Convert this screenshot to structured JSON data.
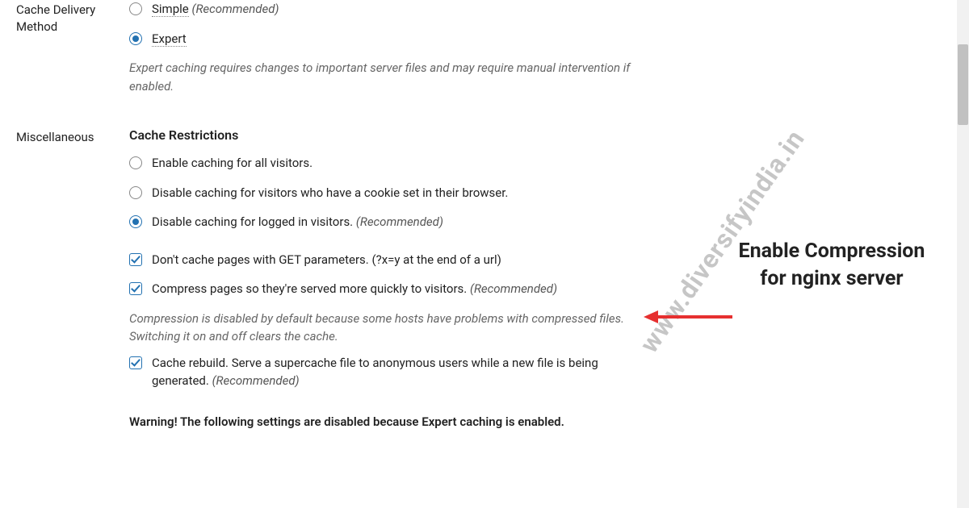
{
  "cache_delivery": {
    "label": "Cache Delivery Method",
    "options": {
      "simple": {
        "label": "Simple",
        "rec": "(Recommended)"
      },
      "expert": {
        "label": "Expert"
      }
    },
    "desc": "Expert caching requires changes to important server files and may require manual intervention if enabled."
  },
  "misc": {
    "label": "Miscellaneous",
    "subhead": "Cache Restrictions",
    "restrictions": {
      "all": "Enable caching for all visitors.",
      "cookie": "Disable caching for visitors who have a cookie set in their browser.",
      "logged": "Disable caching for logged in visitors.",
      "logged_rec": "(Recommended)"
    },
    "get_params": "Don't cache pages with GET parameters. (?x=y at the end of a url)",
    "compress": "Compress pages so they're served more quickly to visitors.",
    "compress_rec": "(Recommended)",
    "compress_desc": "Compression is disabled by default because some hosts have problems with compressed files. Switching it on and off clears the cache.",
    "rebuild": "Cache rebuild. Serve a supercache file to anonymous users while a new file is being generated.",
    "rebuild_rec": "(Recommended)",
    "warning": "Warning! The following settings are disabled because Expert caching is enabled."
  },
  "watermark": "www.diversifyindia.in",
  "annotation": "Enable Compression for nginx server"
}
